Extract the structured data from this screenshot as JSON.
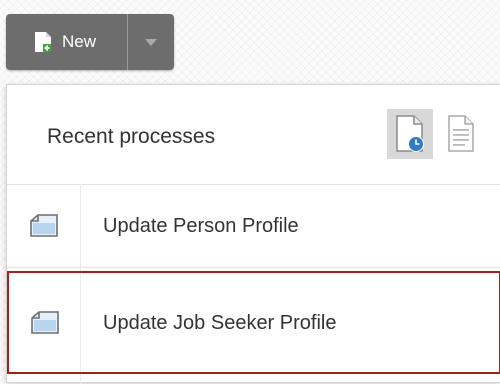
{
  "toolbar": {
    "new_label": "New"
  },
  "dropdown": {
    "title": "Recent processes",
    "items": [
      {
        "label": "Update Person Profile",
        "selected": false
      },
      {
        "label": "Update Job Seeker Profile",
        "selected": true
      }
    ]
  },
  "colors": {
    "button_bg": "#6d6d6d",
    "selection_border": "#a51f1f",
    "accent_blue": "#2f7bc6",
    "green_plus": "#3fa535"
  }
}
